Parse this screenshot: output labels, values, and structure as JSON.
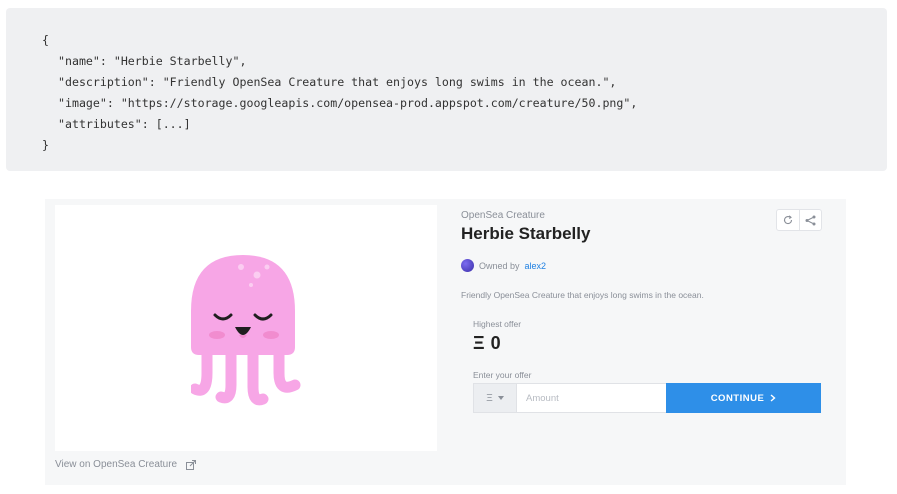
{
  "code": {
    "line1": "{",
    "line2": "\"name\": \"Herbie Starbelly\",",
    "line3": "\"description\": \"Friendly OpenSea Creature that enjoys long swims in the ocean.\",",
    "line4": "\"image\": \"https://storage.googleapis.com/opensea-prod.appspot.com/creature/50.png\",",
    "line5": "\"attributes\": [...]",
    "line6": "}"
  },
  "asset": {
    "collection": "OpenSea Creature",
    "name": "Herbie Starbelly",
    "owned_by_label": "Owned by",
    "owner": "alex2",
    "description": "Friendly OpenSea Creature that enjoys long swims in the ocean.",
    "view_link": "View on OpenSea Creature"
  },
  "offer": {
    "highest_label": "Highest offer",
    "currency_symbol": "Ξ",
    "highest_value": "0",
    "enter_label": "Enter your offer",
    "amount_placeholder": "Amount",
    "continue_label": "CONTINUE"
  },
  "colors": {
    "accent": "#2e8fe8",
    "creature_body": "#f7a6e6",
    "link": "#2081e2"
  },
  "icons": {
    "refresh": "refresh-icon",
    "share": "share-icon",
    "external_link": "external-link-icon",
    "chevron": "chevron-right-icon",
    "dropdown": "caret-down-icon"
  }
}
